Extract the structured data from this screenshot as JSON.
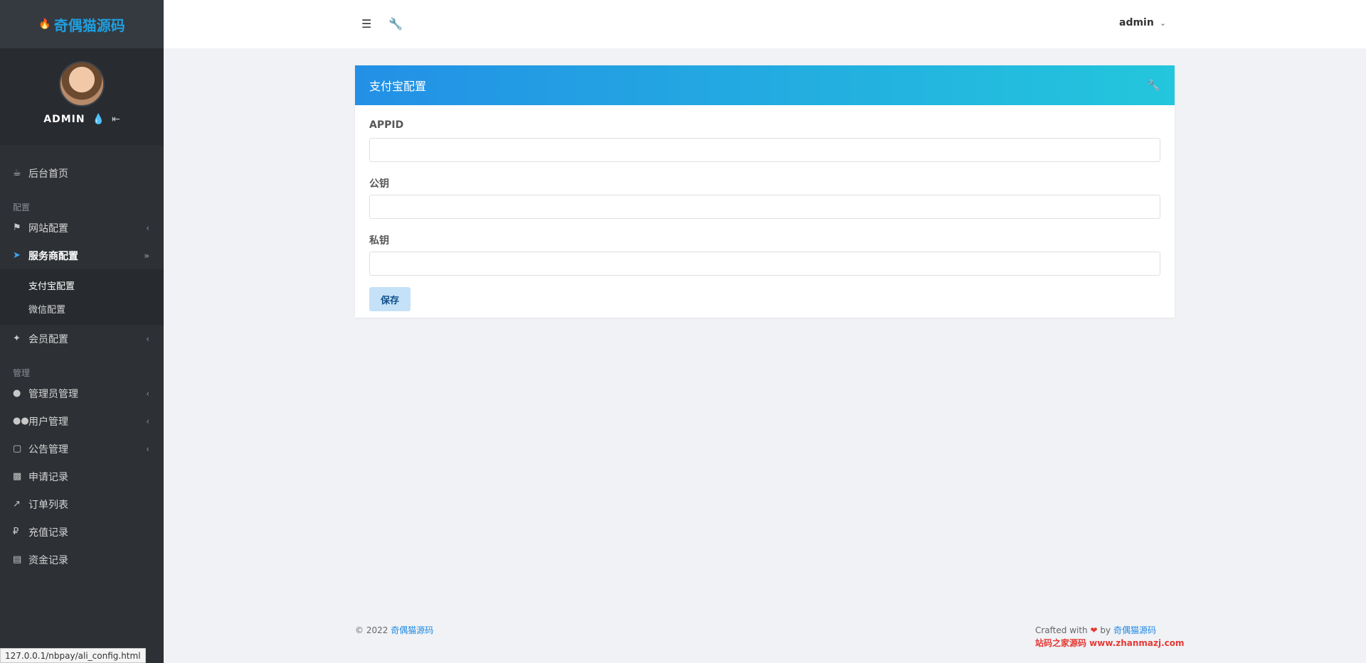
{
  "brand": {
    "icon": "flame-icon",
    "name": "奇偶猫源码"
  },
  "profile": {
    "name": "ADMIN"
  },
  "nav": {
    "home": "后台首页",
    "section_config": "配置",
    "site_config": "网站配置",
    "provider_config": "服务商配置",
    "provider_sub": [
      "支付宝配置",
      "微信配置"
    ],
    "member_config": "会员配置",
    "section_manage": "管理",
    "admin_manage": "管理员管理",
    "user_manage": "用户管理",
    "notice_manage": "公告管理",
    "apply_records": "申请记录",
    "order_list": "订单列表",
    "recharge_records": "充值记录",
    "fund_records": "资金记录"
  },
  "topbar": {
    "user": "admin"
  },
  "card": {
    "title": "支付宝配置",
    "fields": [
      {
        "label": "APPID",
        "value": ""
      },
      {
        "label": "公钥",
        "value": ""
      },
      {
        "label": "私钥",
        "value": ""
      }
    ],
    "save_label": "保存"
  },
  "footer": {
    "copyright": "© 2022",
    "brand_link": "奇偶猫源码",
    "crafted_with": "Crafted with",
    "by": "by",
    "author_link": "奇偶猫源码",
    "watermark": "站码之家源码 www.zhanmazj.com"
  },
  "statusbar": {
    "url": "127.0.0.1/nbpay/ali_config.html"
  },
  "colors": {
    "accent": "#1e9fe0",
    "sidebar_bg": "#2d3035",
    "header_gradient_start": "#2390e6",
    "header_gradient_end": "#23c6dc"
  }
}
